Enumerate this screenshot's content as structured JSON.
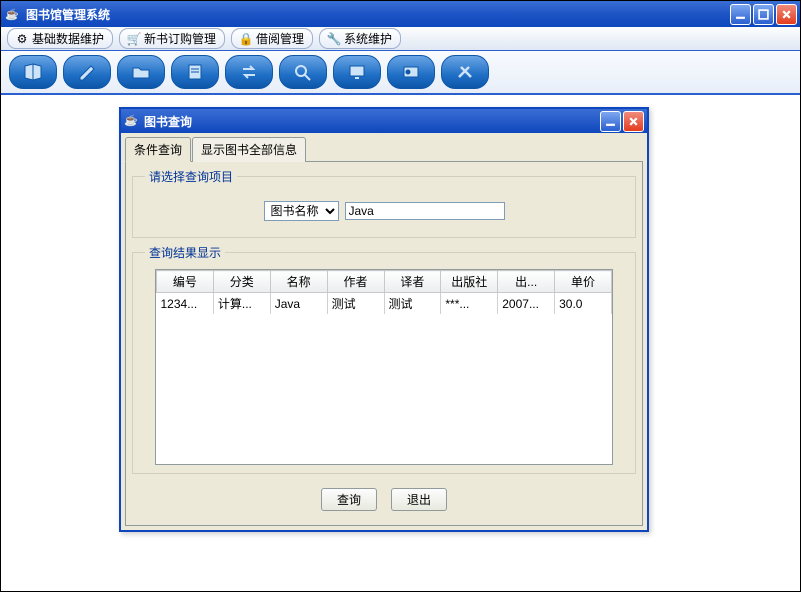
{
  "main_window": {
    "title": "图书馆管理系统"
  },
  "menubar": {
    "items": [
      {
        "label": "基础数据维护",
        "icon": "gear"
      },
      {
        "label": "新书订购管理",
        "icon": "cart"
      },
      {
        "label": "借阅管理",
        "icon": "lock"
      },
      {
        "label": "系统维护",
        "icon": "wrench"
      }
    ]
  },
  "toolbar": {
    "buttons": [
      {
        "name": "tool-1",
        "icon": "book"
      },
      {
        "name": "tool-2",
        "icon": "edit"
      },
      {
        "name": "tool-3",
        "icon": "folder"
      },
      {
        "name": "tool-4",
        "icon": "note"
      },
      {
        "name": "tool-5",
        "icon": "transfer"
      },
      {
        "name": "tool-6",
        "icon": "search"
      },
      {
        "name": "tool-7",
        "icon": "screen"
      },
      {
        "name": "tool-8",
        "icon": "card"
      },
      {
        "name": "tool-9",
        "icon": "tool"
      }
    ]
  },
  "dialog": {
    "title": "图书查询",
    "tabs": [
      {
        "label": "条件查询",
        "active": true
      },
      {
        "label": "显示图书全部信息",
        "active": false
      }
    ],
    "query_section": {
      "legend": "请选择查询项目",
      "combo_selected": "图书名称",
      "input_value": "Java"
    },
    "result_section": {
      "legend": "查询结果显示",
      "columns": [
        "编号",
        "分类",
        "名称",
        "作者",
        "译者",
        "出版社",
        "出...",
        "单价"
      ],
      "rows": [
        [
          "1234...",
          "计算...",
          "Java",
          "测试",
          "测试",
          "***...",
          "2007...",
          "30.0"
        ]
      ]
    },
    "buttons": {
      "query": "查询",
      "exit": "退出"
    }
  }
}
